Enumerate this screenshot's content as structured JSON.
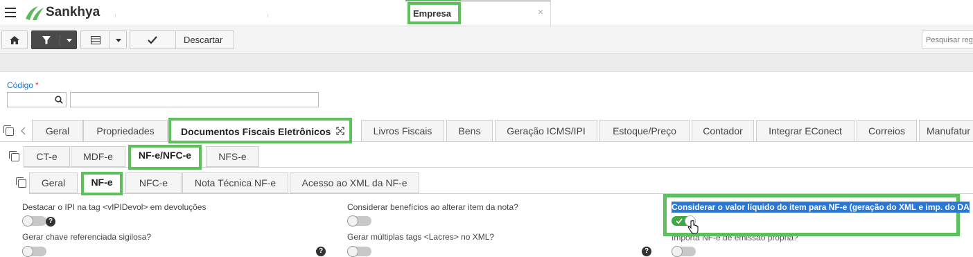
{
  "app": {
    "brand": "Sankhya"
  },
  "window_tab": {
    "title": "Empresa",
    "close": "×"
  },
  "toolbar": {
    "discard_label": "Descartar",
    "search_placeholder": "Pesquisar regi"
  },
  "form": {
    "codigo_label": "Código",
    "required_mark": "*"
  },
  "tabs_level1": [
    "Geral",
    "Propriedades",
    "Documentos Fiscais Eletrônicos",
    "Livros Fiscais",
    "Bens",
    "Geração ICMS/IPI",
    "Estoque/Preço",
    "Contador",
    "Integrar EConect",
    "Correios",
    "Manufatur"
  ],
  "tabs_level1_active": "Documentos Fiscais Eletrônicos",
  "tabs_level2": [
    "CT-e",
    "MDF-e",
    "NF-e/NFC-e",
    "NFS-e"
  ],
  "tabs_level3": [
    "Geral",
    "NF-e",
    "NFC-e",
    "Nota Técnica NF-e",
    "Acesso ao XML da NF-e"
  ],
  "fields": {
    "destacar_ipi": {
      "label": "Destacar o IPI na tag <vIPIDevol> em devoluções",
      "on": false
    },
    "considerar_beneficios": {
      "label": "Considerar benefícios ao alterar item da nota?",
      "on": false
    },
    "considerar_valor_liquido": {
      "label": "Considerar o valor líquido do item para NF-e (geração do XML e imp. do DA",
      "on": true
    },
    "gerar_chave": {
      "label": "Gerar chave referenciada sigilosa?",
      "on": false
    },
    "gerar_lacres": {
      "label": "Gerar múltiplas tags <Lacres> no XML?",
      "on": false
    },
    "importa_nfe": {
      "label": "Importa NF-e de emissão própria?",
      "on": false
    }
  },
  "help_mark": "?",
  "colors": {
    "highlight_green": "#5cc05c",
    "selection_blue": "#2b77d6",
    "toggle_on": "#40a840",
    "link_blue": "#1a73c8"
  }
}
